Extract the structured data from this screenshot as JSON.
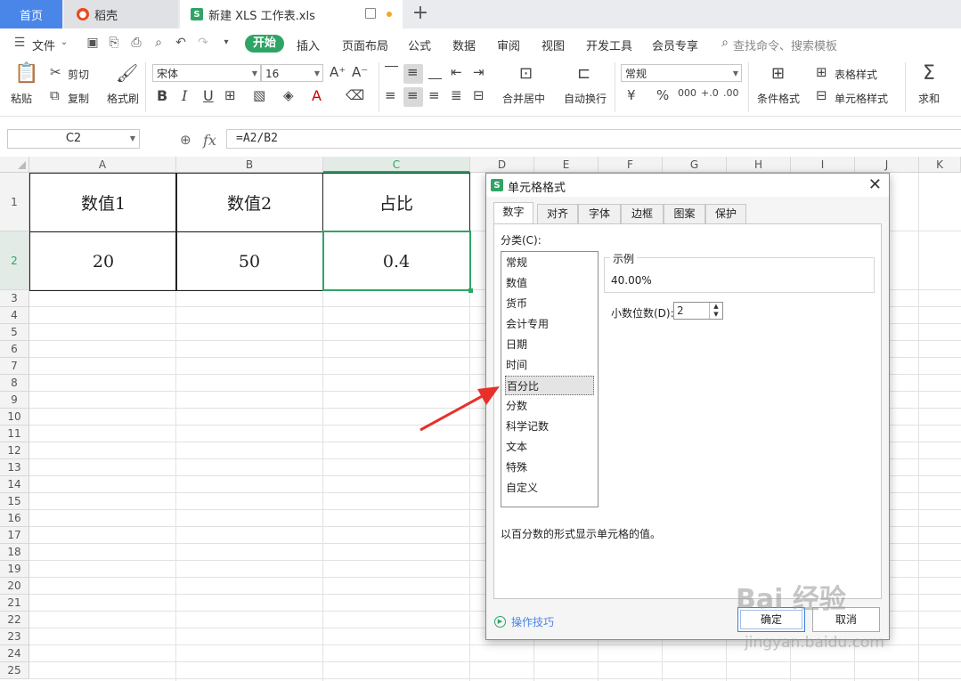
{
  "tabs": {
    "home": "首页",
    "daoke": "稻壳",
    "doc": "新建 XLS 工作表.xls",
    "add": "+"
  },
  "menu": {
    "file": "文件",
    "start": "开始",
    "insert": "插入",
    "layout": "页面布局",
    "formula": "公式",
    "data": "数据",
    "review": "审阅",
    "view": "视图",
    "dev": "开发工具",
    "vip": "会员专享",
    "search": "查找命令、搜索模板"
  },
  "ribbon": {
    "paste": "粘贴",
    "cut": "剪切",
    "copy": "复制",
    "format_painter": "格式刷",
    "font_name": "宋体",
    "font_size": "16",
    "number_format": "常规",
    "merge_center": "合并居中",
    "wrap": "自动换行",
    "cond_format": "条件格式",
    "table_style": "表格样式",
    "cell_style": "单元格样式",
    "sum": "求和",
    "bold": "B",
    "italic": "I",
    "underline": "U",
    "font_color": "A",
    "yen": "¥",
    "percent": "%"
  },
  "formula_bar": {
    "cell_ref": "C2",
    "fx": "fx",
    "formula": "=A2/B2"
  },
  "sheet": {
    "columns": [
      "A",
      "B",
      "C",
      "D",
      "E",
      "F",
      "G",
      "H",
      "I",
      "J",
      "K"
    ],
    "rows": [
      "1",
      "2",
      "3",
      "4",
      "5",
      "6",
      "7",
      "8",
      "9",
      "10",
      "11",
      "12",
      "13",
      "14",
      "15",
      "16",
      "17",
      "18",
      "19",
      "20",
      "21",
      "22",
      "23",
      "24",
      "25"
    ],
    "cells": {
      "A1": "数值1",
      "B1": "数值2",
      "C1": "占比",
      "A2": "20",
      "B2": "50",
      "C2": "0.4"
    }
  },
  "dialog": {
    "title": "单元格格式",
    "close": "✕",
    "tabs": [
      "数字",
      "对齐",
      "字体",
      "边框",
      "图案",
      "保护"
    ],
    "category_label": "分类(C):",
    "categories": [
      "常规",
      "数值",
      "货币",
      "会计专用",
      "日期",
      "时间",
      "百分比",
      "分数",
      "科学记数",
      "文本",
      "特殊",
      "自定义"
    ],
    "selected_category": "百分比",
    "sample_label": "示例",
    "sample_value": "40.00%",
    "decimal_label": "小数位数(D):",
    "decimal_value": "2",
    "description": "以百分数的形式显示单元格的值。",
    "tips": "操作技巧",
    "ok": "确定",
    "cancel": "取消"
  },
  "watermark": {
    "brand": "Bai 经验",
    "url": "jingyan.baidu.com"
  },
  "colors": {
    "accent_green": "#2fa466",
    "home_tab_blue": "#4a86e8",
    "arrow_red": "#e8302a"
  }
}
